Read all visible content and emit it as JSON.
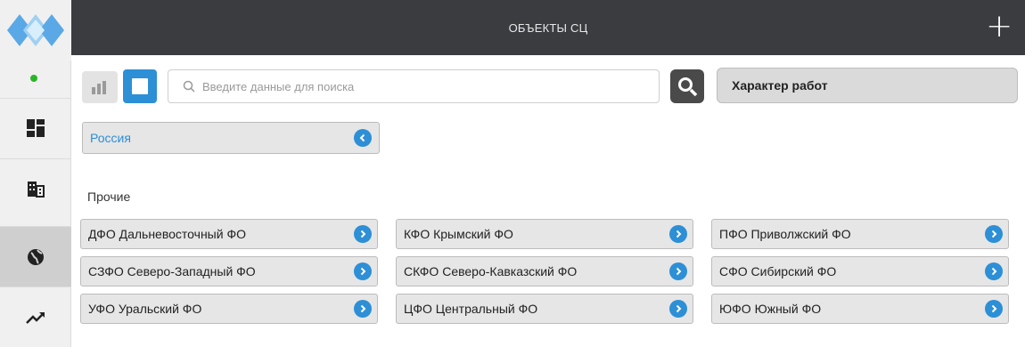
{
  "header": {
    "title": "ОБЪЕКТЫ СЦ",
    "add_label": "+"
  },
  "sidebar": {
    "items": [
      {
        "icon": "dashboard-icon"
      },
      {
        "icon": "building-icon"
      },
      {
        "icon": "globe-icon",
        "active": true
      },
      {
        "icon": "trend-chart-icon"
      }
    ]
  },
  "toolbar": {
    "search_placeholder": "Введите данные для поиска",
    "search_value": "",
    "work_type_label": "Характер работ"
  },
  "country": {
    "label": "Россия"
  },
  "section": {
    "title": "Прочие"
  },
  "districts": [
    {
      "label": "ДФО Дальневосточный ФО"
    },
    {
      "label": "КФО Крымский ФО"
    },
    {
      "label": "ПФО Приволжский ФО"
    },
    {
      "label": "СЗФО Северо-Западный ФО"
    },
    {
      "label": "СКФО Северо-Кавказский ФО"
    },
    {
      "label": "СФО Сибирский ФО"
    },
    {
      "label": "УФО Уральский ФО"
    },
    {
      "label": "ЦФО Центральный ФО"
    },
    {
      "label": "ЮФО Южный ФО"
    }
  ],
  "colors": {
    "accent": "#2d8fd6",
    "header_bg": "#3b3c40",
    "status_online": "#28b628"
  }
}
